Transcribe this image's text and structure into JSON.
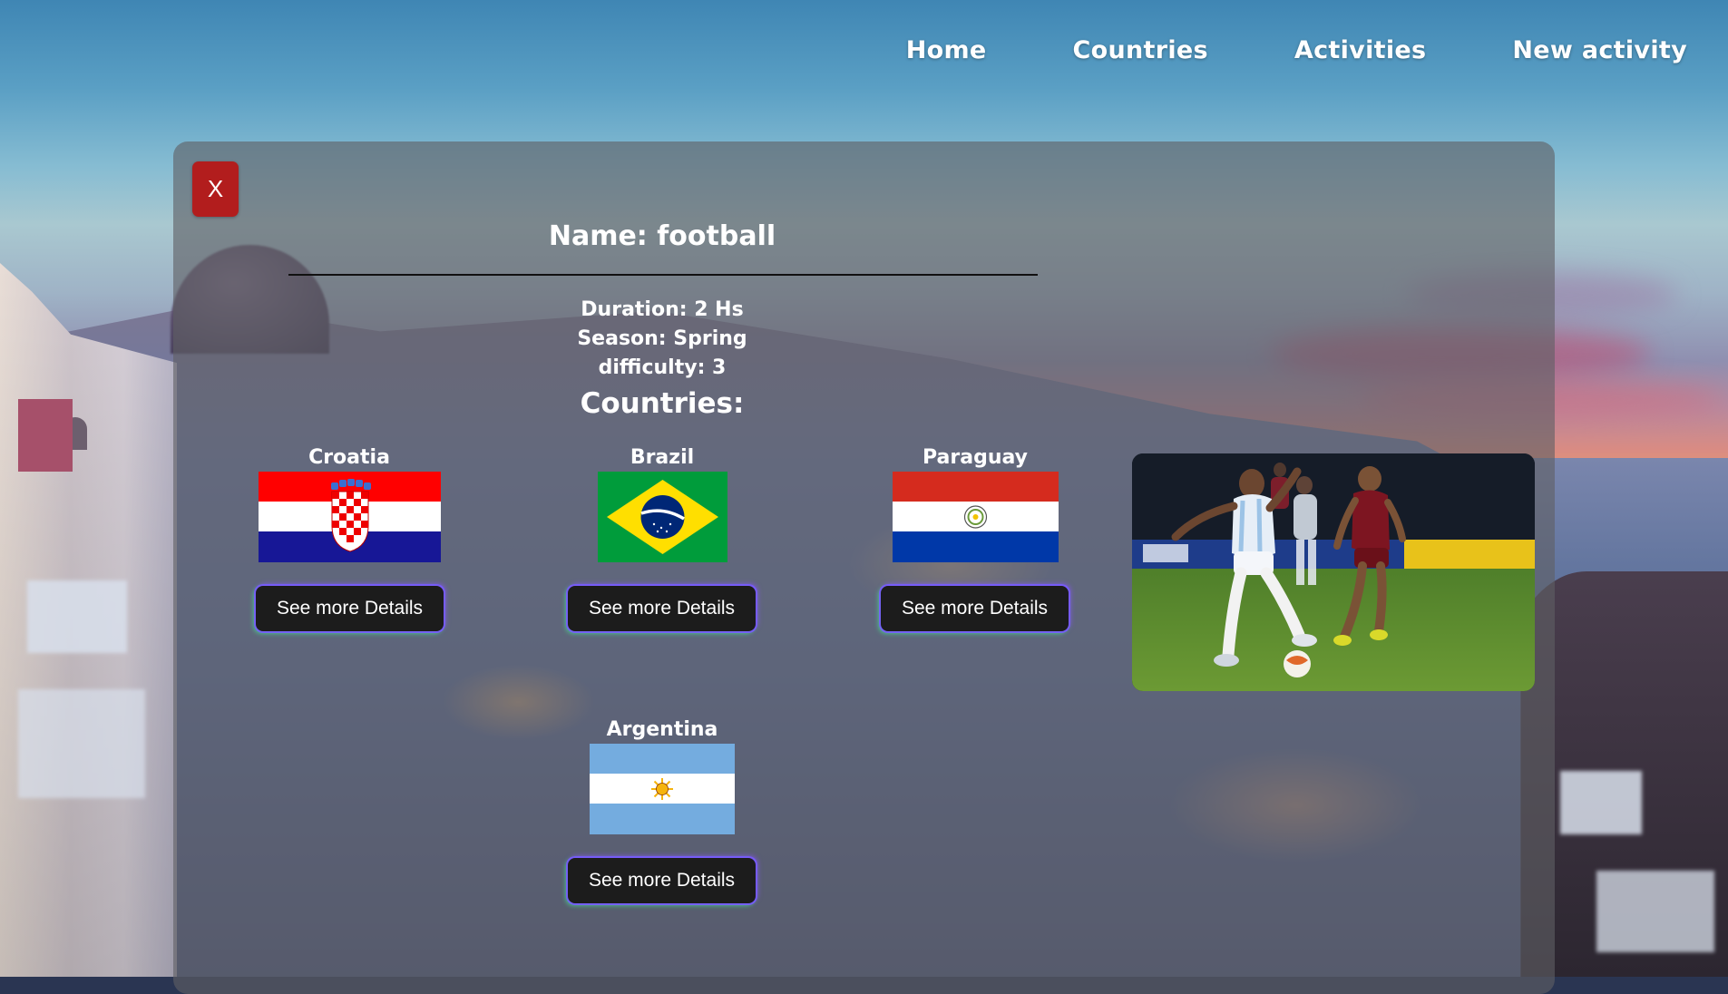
{
  "nav": {
    "items": [
      "Home",
      "Countries",
      "Activities",
      "New activity"
    ]
  },
  "modal": {
    "close_label": "X",
    "title": "Name: football",
    "duration": "Duration: 2 Hs",
    "season": "Season: Spring",
    "difficulty": "difficulty: 3",
    "countries_heading": "Countries:",
    "details_label": "See more Details",
    "countries": [
      {
        "name": "Croatia",
        "flag": "croatia-flag"
      },
      {
        "name": "Brazil",
        "flag": "brazil-flag"
      },
      {
        "name": "Paraguay",
        "flag": "paraguay-flag"
      },
      {
        "name": "Argentina",
        "flag": "argentina-flag"
      }
    ]
  },
  "colors": {
    "close_button": "#b21d1d",
    "details_button": "#1c1c1c",
    "modal_overlay": "#5f5f64"
  }
}
